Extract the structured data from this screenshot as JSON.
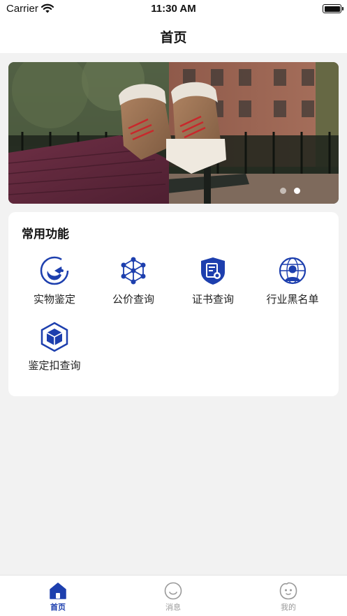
{
  "status_bar": {
    "carrier": "Carrier",
    "time": "11:30 AM"
  },
  "nav": {
    "title": "首页"
  },
  "banner": {
    "slides": 2,
    "active_slide": 2
  },
  "functions": {
    "title": "常用功能",
    "items": [
      {
        "label": "实物鉴定",
        "icon": "scan-face-icon"
      },
      {
        "label": "公价查询",
        "icon": "network-icon"
      },
      {
        "label": "证书查询",
        "icon": "certificate-shield-icon"
      },
      {
        "label": "行业黑名单",
        "icon": "user-globe-icon"
      },
      {
        "label": "鉴定扣查询",
        "icon": "hexagon-box-icon"
      }
    ]
  },
  "tabbar": {
    "items": [
      {
        "label": "首页",
        "icon": "home-icon",
        "active": true
      },
      {
        "label": "消息",
        "icon": "smile-icon",
        "active": false
      },
      {
        "label": "我的",
        "icon": "face-icon",
        "active": false
      }
    ]
  },
  "colors": {
    "accent": "#1d3fae",
    "background": "#f2f2f2",
    "card": "#ffffff"
  }
}
